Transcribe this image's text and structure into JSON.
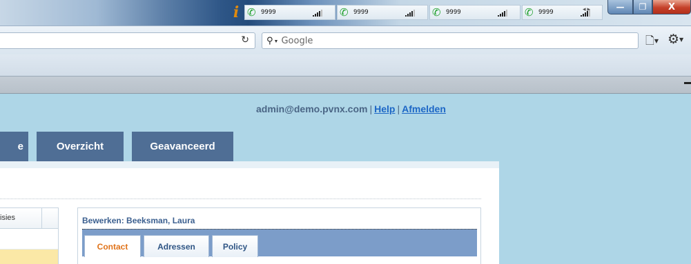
{
  "titlebar": {
    "phones": [
      {
        "number": "9999"
      },
      {
        "number": "9999"
      },
      {
        "number": "9999"
      },
      {
        "number": "9999"
      }
    ],
    "window_buttons": {
      "minimize": "—",
      "maximize": "❐",
      "close": "X"
    }
  },
  "navbar": {
    "search_placeholder": "Google",
    "search_engine_icon": "magnifier-icon",
    "reload_icon": "reload-icon"
  },
  "page": {
    "user_email": "admin@demo.pvnx.com",
    "separator": "|",
    "help_link": "Help",
    "logout_link": "Afmelden",
    "main_tabs": [
      "e",
      "Overzicht",
      "Geavanceerd"
    ],
    "left_grid_header": "isies",
    "edit_panel": {
      "title": "Bewerken: Beeksman, Laura",
      "tabs": [
        "Contact",
        "Adressen",
        "Policy"
      ],
      "active_tab": "Contact"
    }
  },
  "colors": {
    "page_background": "#aed6e7",
    "main_tab": "#4f6e95",
    "edit_tabbar": "#7c9dc9",
    "active_tab_text": "#e0731a",
    "link": "#1d67c6",
    "highlight_row": "#fbe8a6"
  }
}
